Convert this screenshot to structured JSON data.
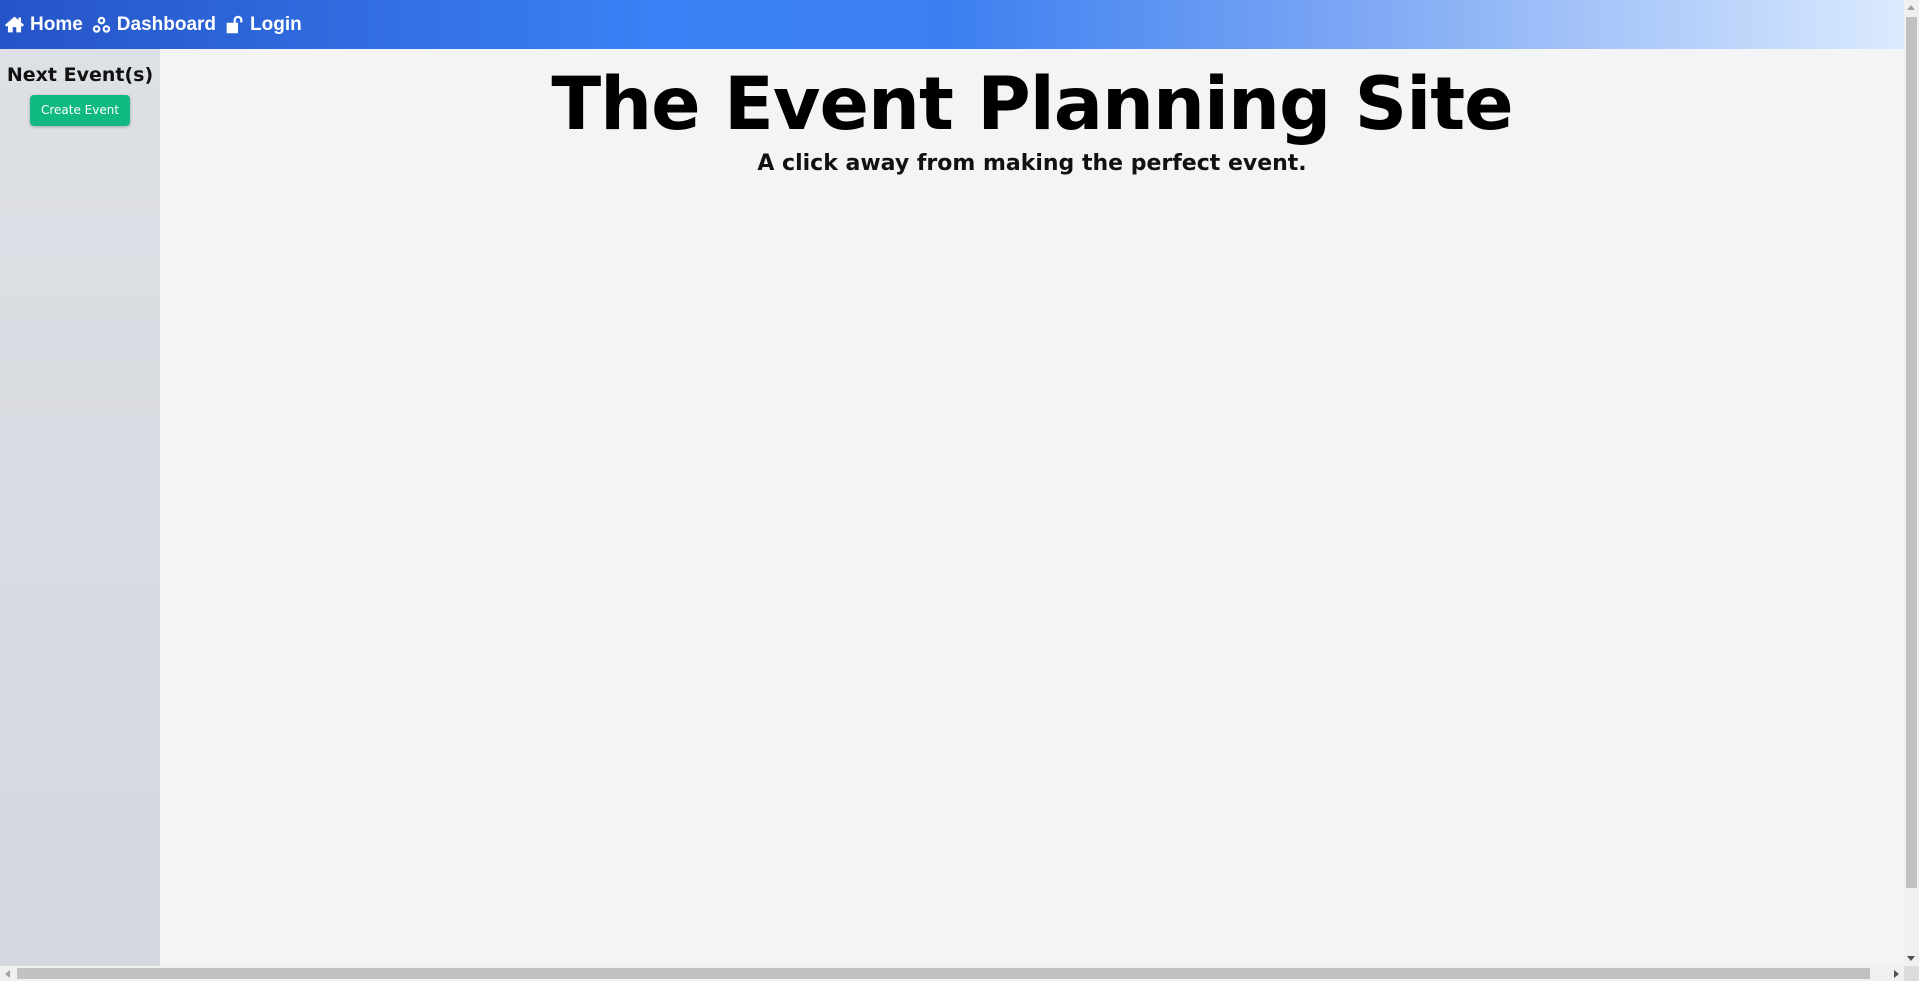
{
  "nav": {
    "items": [
      {
        "label": "Home",
        "icon": "home-icon"
      },
      {
        "label": "Dashboard",
        "icon": "dashboard-icon"
      },
      {
        "label": "Login",
        "icon": "unlock-icon"
      }
    ],
    "colors": {
      "gradient_start": "#2554c7",
      "gradient_mid": "#3b82f6",
      "gradient_end": "#dbeafe"
    }
  },
  "sidebar": {
    "title": "Next Event(s)",
    "create_button_label": "Create Event",
    "button_color": "#10b981"
  },
  "hero": {
    "title": "The Event Planning Site",
    "subtitle": "A click away from making the perfect event."
  }
}
